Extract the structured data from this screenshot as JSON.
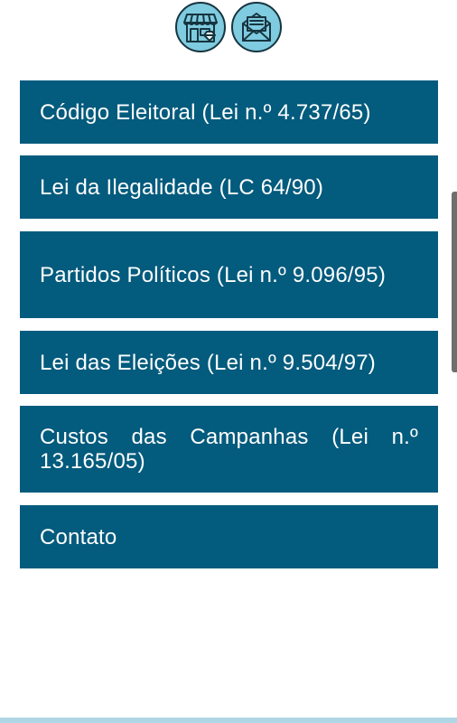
{
  "header": {
    "icons": [
      {
        "name": "store-icon",
        "color": "#7fcbe0"
      },
      {
        "name": "mail-icon",
        "color": "#7fcbe0"
      }
    ]
  },
  "menu": {
    "items": [
      {
        "label": "Código Eleitoral (Lei n.º 4.737/65)"
      },
      {
        "label": "Lei da Ilegalidade (LC 64/90)"
      },
      {
        "label": "Partidos Políticos (Lei n.º 9.096/95)"
      },
      {
        "label": "Lei das Eleições (Lei n.º 9.504/97)"
      },
      {
        "label": "Custos das Campanhas (Lei n.º 13.165/05)"
      },
      {
        "label": "Contato"
      }
    ]
  },
  "colors": {
    "button_bg": "#035b7d",
    "button_text": "#ffffff",
    "icon_bg": "#7fcbe0",
    "icon_stroke": "#16353f",
    "bottom_bar": "#aed6e5"
  }
}
